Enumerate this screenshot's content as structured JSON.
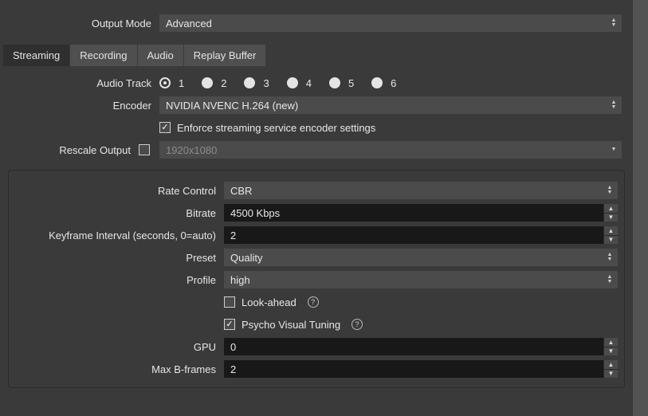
{
  "top": {
    "output_mode_label": "Output Mode",
    "output_mode_value": "Advanced"
  },
  "tabs": {
    "streaming": "Streaming",
    "recording": "Recording",
    "audio": "Audio",
    "replay_buffer": "Replay Buffer"
  },
  "mid": {
    "audio_track_label": "Audio Track",
    "tracks": {
      "t1": "1",
      "t2": "2",
      "t3": "3",
      "t4": "4",
      "t5": "5",
      "t6": "6"
    },
    "encoder_label": "Encoder",
    "encoder_value": "NVIDIA NVENC H.264 (new)",
    "enforce_label": "Enforce streaming service encoder settings",
    "rescale_label": "Rescale Output",
    "rescale_value": "1920x1080"
  },
  "group": {
    "rate_control_label": "Rate Control",
    "rate_control_value": "CBR",
    "bitrate_label": "Bitrate",
    "bitrate_value": "4500 Kbps",
    "keyframe_label": "Keyframe Interval (seconds, 0=auto)",
    "keyframe_value": "2",
    "preset_label": "Preset",
    "preset_value": "Quality",
    "profile_label": "Profile",
    "profile_value": "high",
    "lookahead_label": "Look-ahead",
    "psycho_label": "Psycho Visual Tuning",
    "gpu_label": "GPU",
    "gpu_value": "0",
    "bframes_label": "Max B-frames",
    "bframes_value": "2"
  }
}
